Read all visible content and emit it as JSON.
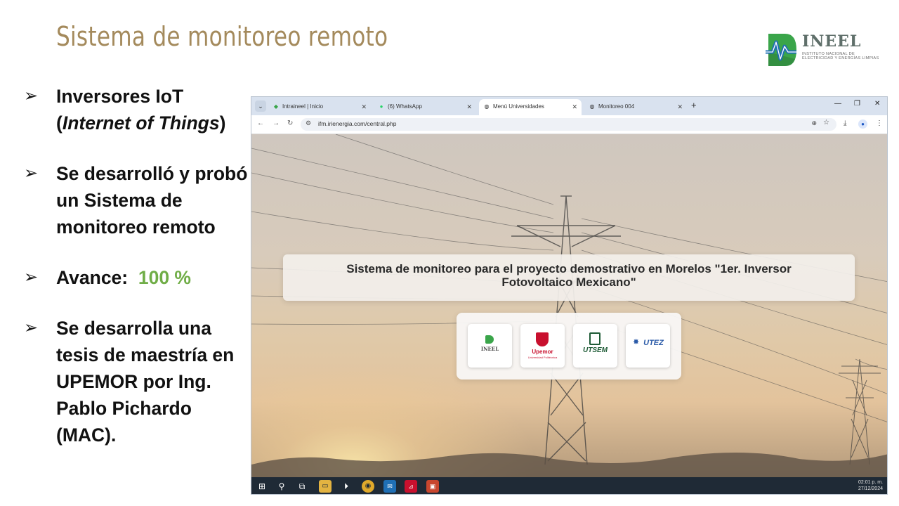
{
  "slide": {
    "title": "Sistema de monitoreo remoto",
    "logo": {
      "name": "INEEL",
      "subtitle": "INSTITUTO NACIONAL DE ELECTRICIDAD Y ENERGÍAS LIMPIAS"
    },
    "bullets": [
      {
        "line1": "Inversores IoT",
        "line2_open": "(",
        "line2_italic": "Internet of Things",
        "line2_close": ")"
      },
      {
        "text": "Se desarrolló y probó un Sistema de monitoreo remoto"
      },
      {
        "label": "Avance:",
        "value": "100 %"
      },
      {
        "text": "Se desarrolla una tesis de maestría en UPEMOR por Ing. Pablo Pichardo (MAC)."
      }
    ],
    "arrow_glyph": "➢"
  },
  "browser": {
    "tabs": [
      {
        "label": "Intraineel | Inicio",
        "icon": "intraineel-icon"
      },
      {
        "label": "(6) WhatsApp",
        "icon": "whatsapp-icon"
      },
      {
        "label": "Menú Universidades",
        "icon": "globe-icon",
        "active": true
      },
      {
        "label": "Monitoreo 004",
        "icon": "globe-icon"
      }
    ],
    "url": "ifm.irienergia.com/central.php"
  },
  "page": {
    "headline": "Sistema de monitoreo para el proyecto demostrativo en Morelos \"1er. Inversor Fotovoltaico Mexicano\"",
    "universities": [
      {
        "name": "INEEL",
        "color": "#4a4a4a"
      },
      {
        "name": "Upemor",
        "color": "#c8102e",
        "sub": "Universidad Politécnica"
      },
      {
        "name": "UTSEM",
        "color": "#1e5b36"
      },
      {
        "name": "UTEZ",
        "color": "#2a5aa8"
      }
    ]
  },
  "taskbar": {
    "time": "02:01 p. m.",
    "date": "27/12/2024"
  },
  "colors": {
    "title": "#a48a5c",
    "accent_green": "#70ad47",
    "ineel_green": "#3aa54a",
    "ineel_blue": "#1f6fb5"
  }
}
